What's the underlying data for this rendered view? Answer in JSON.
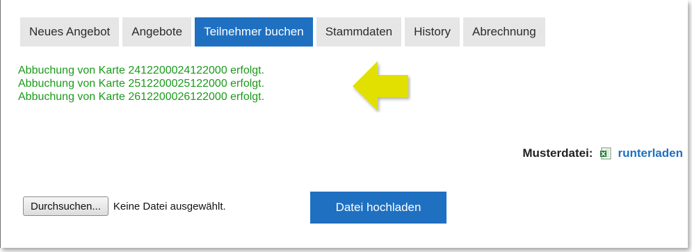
{
  "tabs": [
    {
      "label": "Neues Angebot",
      "active": false
    },
    {
      "label": "Angebote",
      "active": false
    },
    {
      "label": "Teilnehmer buchen",
      "active": true
    },
    {
      "label": "Stammdaten",
      "active": false
    },
    {
      "label": "History",
      "active": false
    },
    {
      "label": "Abrechnung",
      "active": false
    }
  ],
  "messages": [
    "Abbuchung von Karte 2412200024122000 erfolgt.",
    "Abbuchung von Karte 2512200025122000 erfolgt.",
    "Abbuchung von Karte 2612200026122000 erfolgt."
  ],
  "musterdatei": {
    "label": "Musterdatei:",
    "icon": "excel-file-icon",
    "link": "runterladen"
  },
  "upload": {
    "browse_label": "Durchsuchen...",
    "no_file_text": "Keine Datei ausgewählt.",
    "upload_label": "Datei hochladen"
  },
  "colors": {
    "accent": "#1f70c1",
    "success": "#1a9a1a",
    "arrow": "#e2e000"
  }
}
